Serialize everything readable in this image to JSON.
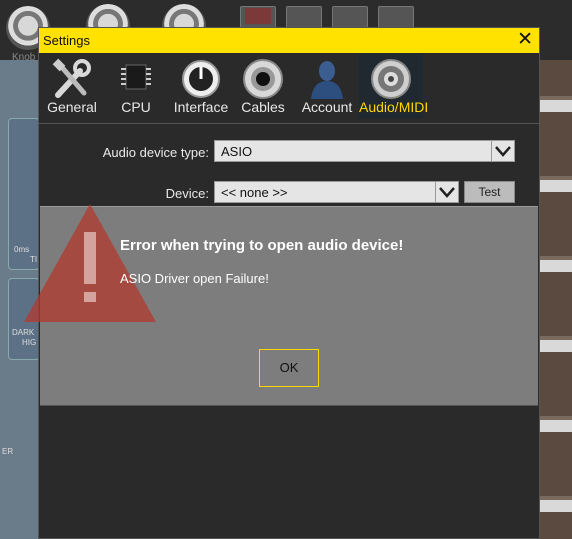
{
  "background": {
    "knob_label": "Knob",
    "left_labels": [
      "0ms",
      "TI",
      "DARK",
      "HIG",
      "ER"
    ]
  },
  "dialog": {
    "title": "Settings",
    "close_glyph": "✕",
    "tabs": [
      {
        "label": "General",
        "icon": "tools-icon",
        "active": false
      },
      {
        "label": "CPU",
        "icon": "chip-icon",
        "active": false
      },
      {
        "label": "Interface",
        "icon": "knob-icon",
        "active": false
      },
      {
        "label": "Cables",
        "icon": "jack-icon",
        "active": false
      },
      {
        "label": "Account",
        "icon": "user-icon",
        "active": false
      },
      {
        "label": "Audio/MIDI",
        "icon": "speaker-icon",
        "active": true
      }
    ],
    "audio_device_type": {
      "label": "Audio device type:",
      "value": "ASIO"
    },
    "device": {
      "label": "Device:",
      "value": "<< none >>",
      "test_label": "Test"
    }
  },
  "alert": {
    "title": "Error when trying to open audio device!",
    "message": "ASIO Driver open Failure!",
    "ok_label": "OK",
    "icon": "warning-icon"
  },
  "colors": {
    "titlebar": "#ffe200",
    "accent": "#ffd700",
    "warning": "#b23a2e"
  }
}
